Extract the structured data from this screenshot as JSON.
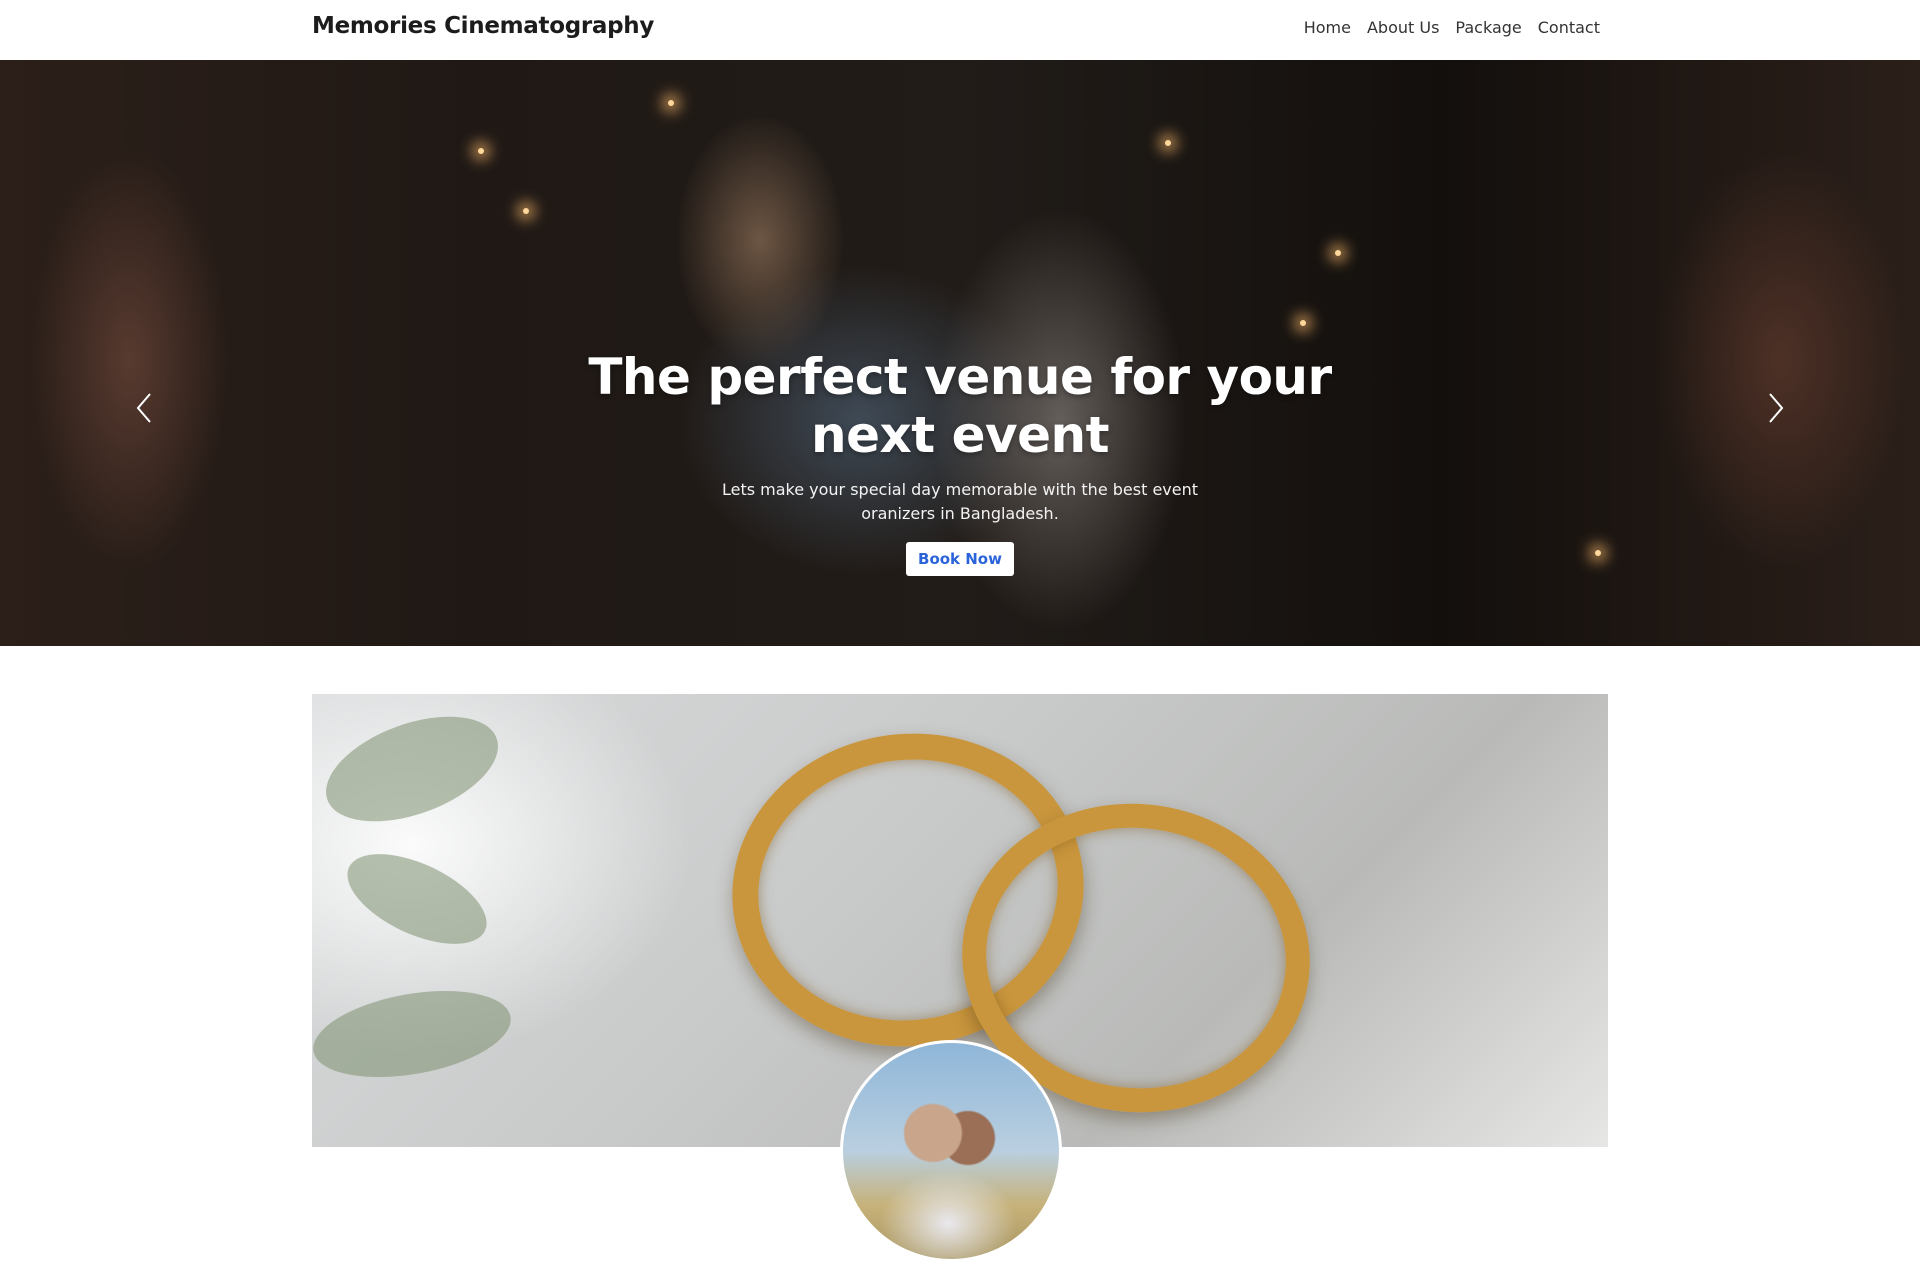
{
  "navbar": {
    "brand": "Memories Cinematography",
    "links": [
      "Home",
      "About Us",
      "Package",
      "Contact"
    ]
  },
  "hero": {
    "title_line1": "The perfect venue for your",
    "title_line2": "next event",
    "subtitle": "Lets make your special day memorable with the best event oranizers in Bangladesh.",
    "cta_label": "Book Now",
    "slide_count": 3,
    "active_slide": 2
  },
  "icons": {
    "prev": "chevron-left-icon",
    "next": "chevron-right-icon"
  },
  "colors": {
    "cta_text": "#2b63d9",
    "brand_text": "#1c1c1c"
  }
}
